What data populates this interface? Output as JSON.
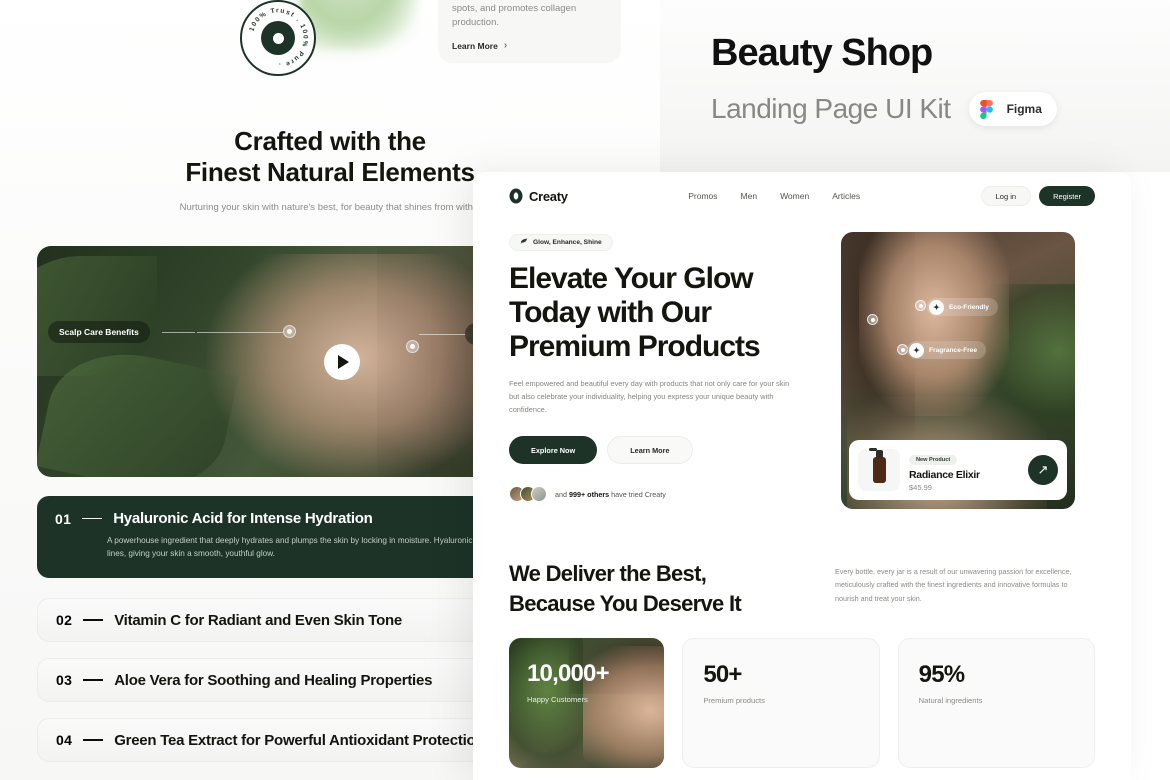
{
  "header": {
    "title": "Beauty Shop",
    "subtitle": "Landing Page UI Kit",
    "tool_badge": "Figma",
    "tool_icon": "figma-icon"
  },
  "showcase": {
    "seal_text": "100% Trust . 100% Pure .",
    "info_card": {
      "body": "Brightens the skin, reduces dark spots, and promotes collagen production.",
      "link": "Learn More",
      "chevron": "›"
    },
    "heading_line1": "Crafted with the",
    "heading_line2": "Finest Natural Elements",
    "subheading": "Nurturing your skin with nature's best, for beauty that shines from within",
    "video": {
      "play_icon": "play-icon",
      "hotspots": [
        {
          "label": "Scalp Care Benefits"
        },
        {
          "label": ""
        }
      ]
    },
    "accordion": [
      {
        "number": "01",
        "title": "Hyaluronic Acid for Intense Hydration",
        "body": "A powerhouse ingredient that deeply hydrates and plumps the skin by locking in moisture. Hyaluronic Acid helps reduce the appearance of fine lines, giving your skin a smooth, youthful glow.",
        "open": true
      },
      {
        "number": "02",
        "title": "Vitamin C for Radiant and Even Skin Tone",
        "body": "",
        "open": false
      },
      {
        "number": "03",
        "title": "Aloe Vera for Soothing and Healing Properties",
        "body": "",
        "open": false
      },
      {
        "number": "04",
        "title": "Green Tea Extract for Powerful Antioxidant Protection",
        "body": "",
        "open": false
      }
    ]
  },
  "mockup": {
    "nav": {
      "brand": "Creaty",
      "brand_icon": "creaty-logo-icon",
      "links": [
        "Promos",
        "Men",
        "Women",
        "Articles"
      ],
      "login_label": "Log in",
      "register_label": "Register"
    },
    "hero": {
      "pill_label": "Glow, Enhance, Shine",
      "pill_icon": "leaf-sprout-icon",
      "heading": "Elevate Your Glow Today with Our Premium Products",
      "paragraph": "Feel empowered and beautiful every day with products that not only care for your skin but also celebrate your individuality, helping you express your unique beauty with confidence.",
      "primary_button": "Explore Now",
      "secondary_button": "Learn More",
      "social_prefix": "and ",
      "social_count": "999+ others",
      "social_suffix": " have tried Creaty",
      "tags": [
        {
          "label": "Eco-Friendly",
          "icon": "sparkle-icon"
        },
        {
          "label": "Fragrance-Free",
          "icon": "sparkle-icon"
        }
      ],
      "product": {
        "badge": "New Product",
        "name": "Radiance Elixir",
        "price": "$45.99",
        "cta_icon": "arrow-up-right-icon"
      }
    },
    "deliver": {
      "heading_line1": "We Deliver the Best,",
      "heading_line2": "Because You Deserve It",
      "paragraph": "Every bottle, every jar is a result of our unwavering passion for excellence, meticulously crafted with the finest ingredients and innovative formulas to nourish and treat your skin.",
      "stats": [
        {
          "value": "10,000+",
          "label": "Happy Customers",
          "photo": true
        },
        {
          "value": "50+",
          "label": "Premium products",
          "photo": false
        },
        {
          "value": "95%",
          "label": "Natural ingredients",
          "photo": false
        }
      ]
    }
  },
  "colors": {
    "brand_green": "#1d3328",
    "ink": "#15150f",
    "muted": "#8a8a84",
    "surface": "#fafafa"
  }
}
